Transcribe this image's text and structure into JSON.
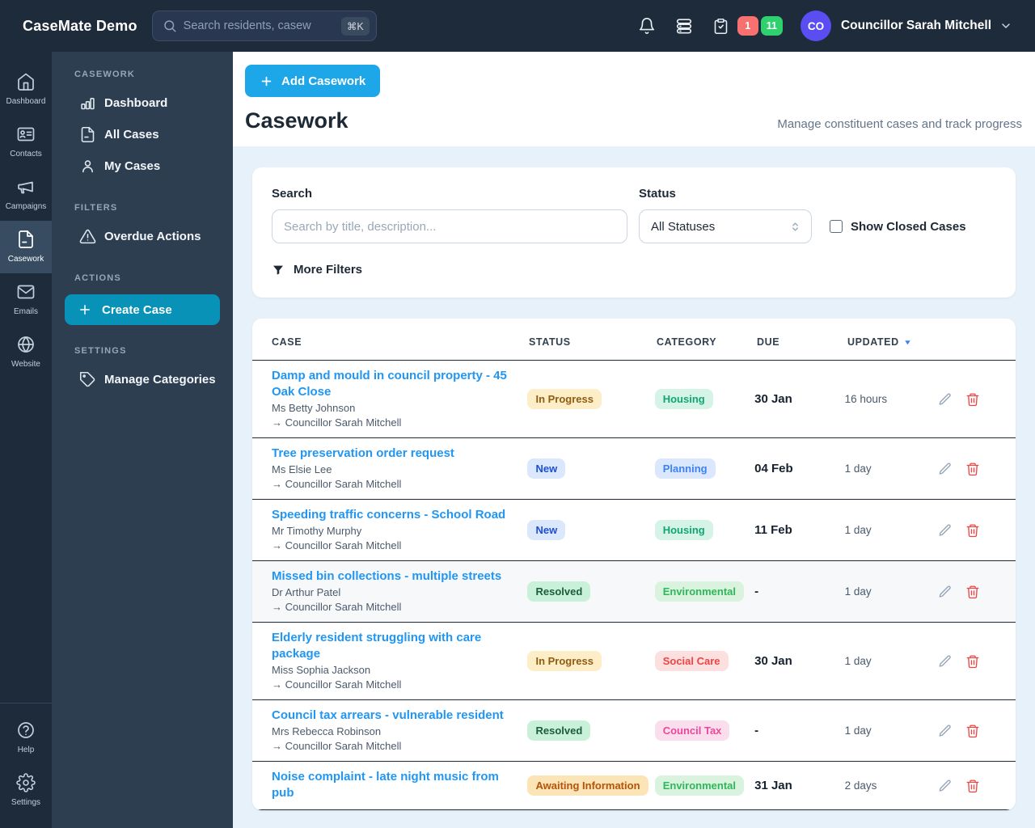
{
  "topbar": {
    "brand": "CaseMate Demo",
    "search_placeholder": "Search residents, casew",
    "shortcut": "⌘K",
    "badges": {
      "red": "1",
      "green": "11"
    },
    "avatar_initials": "CO",
    "user_name": "Councillor Sarah Mitchell"
  },
  "rail": {
    "items": [
      {
        "label": "Dashboard",
        "icon": "home-icon",
        "active": false
      },
      {
        "label": "Contacts",
        "icon": "contacts-icon",
        "active": false
      },
      {
        "label": "Campaigns",
        "icon": "megaphone-icon",
        "active": false
      },
      {
        "label": "Casework",
        "icon": "document-icon",
        "active": true
      },
      {
        "label": "Emails",
        "icon": "mail-icon",
        "active": false
      },
      {
        "label": "Website",
        "icon": "globe-icon",
        "active": false
      }
    ],
    "bottom": [
      {
        "label": "Help",
        "icon": "help-circle-icon"
      },
      {
        "label": "Settings",
        "icon": "gear-icon"
      }
    ]
  },
  "sidebar": {
    "sections": [
      {
        "title": "CASEWORK",
        "items": [
          {
            "label": "Dashboard",
            "icon": "bar-chart-icon"
          },
          {
            "label": "All Cases",
            "icon": "file-icon"
          },
          {
            "label": "My Cases",
            "icon": "user-icon"
          }
        ]
      },
      {
        "title": "FILTERS",
        "items": [
          {
            "label": "Overdue Actions",
            "icon": "warning-triangle-icon"
          }
        ]
      },
      {
        "title": "ACTIONS",
        "items": [
          {
            "label": "Create Case",
            "icon": "plus-icon",
            "type": "button"
          }
        ]
      },
      {
        "title": "SETTINGS",
        "items": [
          {
            "label": "Manage Categories",
            "icon": "tag-icon"
          }
        ]
      }
    ]
  },
  "header": {
    "add_button_label": "Add Casework",
    "title": "Casework",
    "subtitle": "Manage constituent cases and track progress"
  },
  "filters": {
    "search_label": "Search",
    "search_placeholder": "Search by title, description...",
    "status_label": "Status",
    "status_value": "All Statuses",
    "show_closed_label": "Show Closed Cases",
    "more_filters_label": "More Filters"
  },
  "table": {
    "columns": [
      "CASE",
      "STATUS",
      "CATEGORY",
      "DUE",
      "UPDATED"
    ],
    "sorted_column": "UPDATED",
    "sort_direction": "desc",
    "rows": [
      {
        "title": "Damp and mould in council property - 45 Oak Close",
        "contact": "Ms Betty Johnson",
        "assignee": "→ Councillor Sarah Mitchell",
        "status": "In Progress",
        "category": "Housing",
        "due": "30 Jan",
        "updated": "16 hours",
        "highlight": false
      },
      {
        "title": "Tree preservation order request",
        "contact": "Ms Elsie Lee",
        "assignee": "→ Councillor Sarah Mitchell",
        "status": "New",
        "category": "Planning",
        "due": "04 Feb",
        "updated": "1 day",
        "highlight": false
      },
      {
        "title": "Speeding traffic concerns - School Road",
        "contact": "Mr Timothy Murphy",
        "assignee": "→ Councillor Sarah Mitchell",
        "status": "New",
        "category": "Housing",
        "due": "11 Feb",
        "updated": "1 day",
        "highlight": false
      },
      {
        "title": "Missed bin collections - multiple streets",
        "contact": "Dr Arthur Patel",
        "assignee": "→ Councillor Sarah Mitchell",
        "status": "Resolved",
        "category": "Environmental",
        "due": "-",
        "updated": "1 day",
        "highlight": true
      },
      {
        "title": "Elderly resident struggling with care package",
        "contact": "Miss Sophia Jackson",
        "assignee": "→ Councillor Sarah Mitchell",
        "status": "In Progress",
        "category": "Social Care",
        "due": "30 Jan",
        "updated": "1 day",
        "highlight": false
      },
      {
        "title": "Council tax arrears - vulnerable resident",
        "contact": "Mrs Rebecca Robinson",
        "assignee": "→ Councillor Sarah Mitchell",
        "status": "Resolved",
        "category": "Council Tax",
        "due": "-",
        "updated": "1 day",
        "highlight": false
      },
      {
        "title": "Noise complaint - late night music from pub",
        "contact": "",
        "assignee": "",
        "status": "Awaiting Information",
        "category": "Environmental",
        "due": "31 Jan",
        "updated": "2 days",
        "highlight": false
      }
    ]
  },
  "badge_styles": {
    "status": {
      "In Progress": {
        "bg": "#fdeec7",
        "fg": "#8f5c12"
      },
      "New": {
        "bg": "#dbe7fb",
        "fg": "#1d4ed8"
      },
      "Resolved": {
        "bg": "#c9f0d9",
        "fg": "#1b5e3a"
      },
      "Awaiting Information": {
        "bg": "#fbe4b5",
        "fg": "#b45309"
      }
    },
    "category": {
      "Housing": {
        "bg": "#d6f3e7",
        "fg": "#10a574"
      },
      "Planning": {
        "bg": "#dbe7fd",
        "fg": "#3b82f6"
      },
      "Environmental": {
        "bg": "#d9f3de",
        "fg": "#2fb75b"
      },
      "Social Care": {
        "bg": "#fcdfdf",
        "fg": "#ef4444"
      },
      "Council Tax": {
        "bg": "#fbdeed",
        "fg": "#ec4899"
      }
    }
  },
  "colors": {
    "topbar_bg": "#1d2b3a",
    "sidebar_bg": "#2d3e50",
    "content_bg": "#e7f1fa",
    "accent_blue": "#1ea7e8",
    "create_button": "#0892b8",
    "link_blue": "#2196f3",
    "avatar_bg": "#5a4df2",
    "notification_red": "#f87171",
    "notification_green": "#2ed16e",
    "sort_arrow": "#3b82f6"
  }
}
